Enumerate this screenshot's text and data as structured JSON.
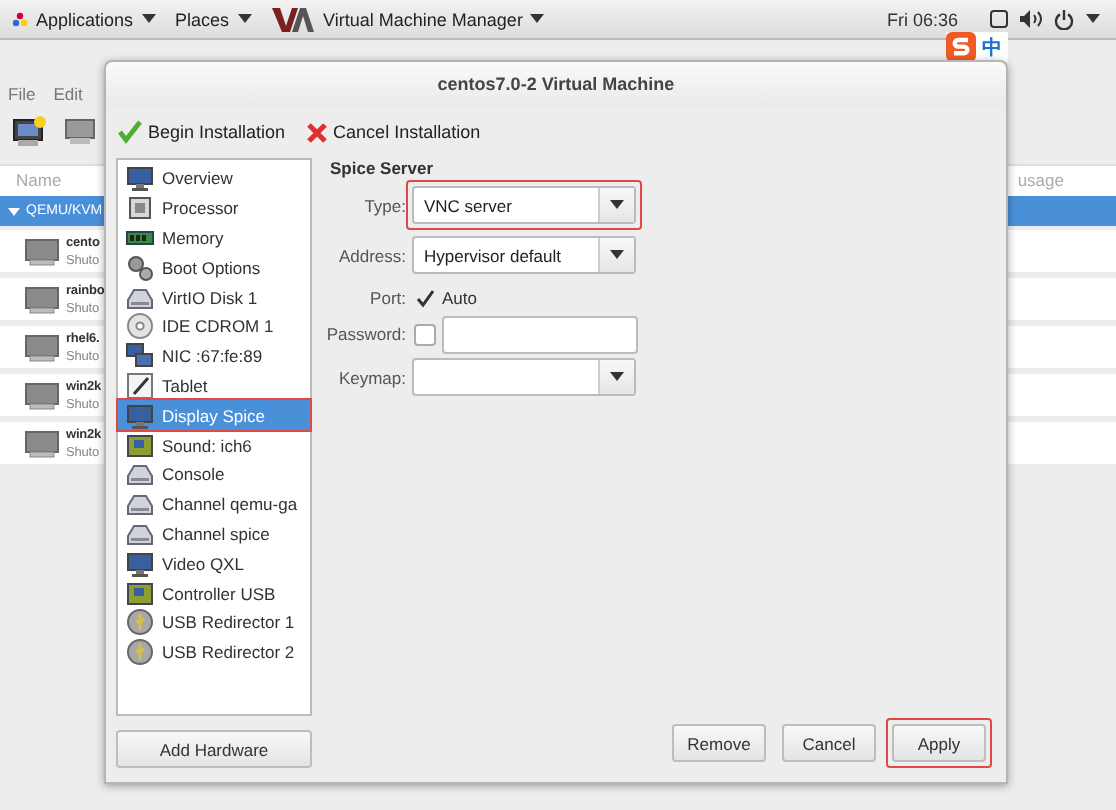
{
  "top_bar": {
    "menus": [
      {
        "label": "Applications",
        "kind": "apps"
      },
      {
        "label": "Places",
        "kind": "plain"
      },
      {
        "label": "Virtual Machine Manager",
        "kind": "app"
      }
    ],
    "clock": "Fri 06:36"
  },
  "ime": {
    "label": "中"
  },
  "background_window": {
    "menu": [
      "File",
      "Edit"
    ],
    "columns": [
      "Name",
      "usage"
    ],
    "group": {
      "label": "QEMU/KVM",
      "expanded": true,
      "selected": true
    },
    "vms": [
      {
        "name": "cento",
        "status": "Shuto"
      },
      {
        "name": "rainbo",
        "status": "Shuto"
      },
      {
        "name": "rhel6.",
        "status": "Shuto"
      },
      {
        "name": "win2k",
        "status": "Shuto"
      },
      {
        "name": "win2k",
        "status": "Shuto"
      }
    ]
  },
  "dialog": {
    "title": "centos7.0-2 Virtual Machine",
    "toolbar": [
      {
        "kind": "begin",
        "label": "Begin Installation"
      },
      {
        "kind": "cancel",
        "label": "Cancel Installation"
      }
    ],
    "hardware": [
      {
        "kind": "monitor",
        "label": "Overview",
        "selected": false,
        "highlighted": false
      },
      {
        "kind": "cpu",
        "label": "Processor",
        "selected": false,
        "highlighted": false
      },
      {
        "kind": "memory",
        "label": "Memory",
        "selected": false,
        "highlighted": false
      },
      {
        "kind": "gears",
        "label": "Boot Options",
        "selected": false,
        "highlighted": false
      },
      {
        "kind": "disk",
        "label": "VirtIO Disk 1",
        "selected": false,
        "highlighted": false
      },
      {
        "kind": "cdrom",
        "label": "IDE CDROM 1",
        "selected": false,
        "highlighted": false
      },
      {
        "kind": "nic",
        "label": "NIC :67:fe:89",
        "selected": false,
        "highlighted": false
      },
      {
        "kind": "tablet",
        "label": "Tablet",
        "selected": false,
        "highlighted": false
      },
      {
        "kind": "monitor",
        "label": "Display Spice",
        "selected": true,
        "highlighted": true
      },
      {
        "kind": "board",
        "label": "Sound: ich6",
        "selected": false,
        "highlighted": false
      },
      {
        "kind": "disk",
        "label": "Console",
        "selected": false,
        "highlighted": false
      },
      {
        "kind": "disk",
        "label": "Channel qemu-ga",
        "selected": false,
        "highlighted": false
      },
      {
        "kind": "disk",
        "label": "Channel spice",
        "selected": false,
        "highlighted": false
      },
      {
        "kind": "monitor",
        "label": "Video QXL",
        "selected": false,
        "highlighted": false
      },
      {
        "kind": "board",
        "label": "Controller USB",
        "selected": false,
        "highlighted": false
      },
      {
        "kind": "usb",
        "label": "USB Redirector 1",
        "selected": false,
        "highlighted": false
      },
      {
        "kind": "usb",
        "label": "USB Redirector 2",
        "selected": false,
        "highlighted": false
      }
    ],
    "add_hardware": "Add Hardware",
    "section": "Spice Server",
    "fields": [
      {
        "kind": "combo",
        "label": "Type:",
        "value": "VNC server",
        "highlighted": true
      },
      {
        "kind": "combo",
        "label": "Address:",
        "value": "Hypervisor default",
        "highlighted": false
      },
      {
        "kind": "check",
        "label": "Port:",
        "checked": true,
        "text": "Auto"
      },
      {
        "kind": "checkentry",
        "label": "Password:",
        "checked": false
      },
      {
        "kind": "combo",
        "label": "Keymap:",
        "highlighted": false
      }
    ],
    "buttons": [
      {
        "label": "Remove",
        "highlighted": false
      },
      {
        "label": "Cancel",
        "highlighted": false
      },
      {
        "label": "Apply",
        "highlighted": true
      }
    ]
  }
}
